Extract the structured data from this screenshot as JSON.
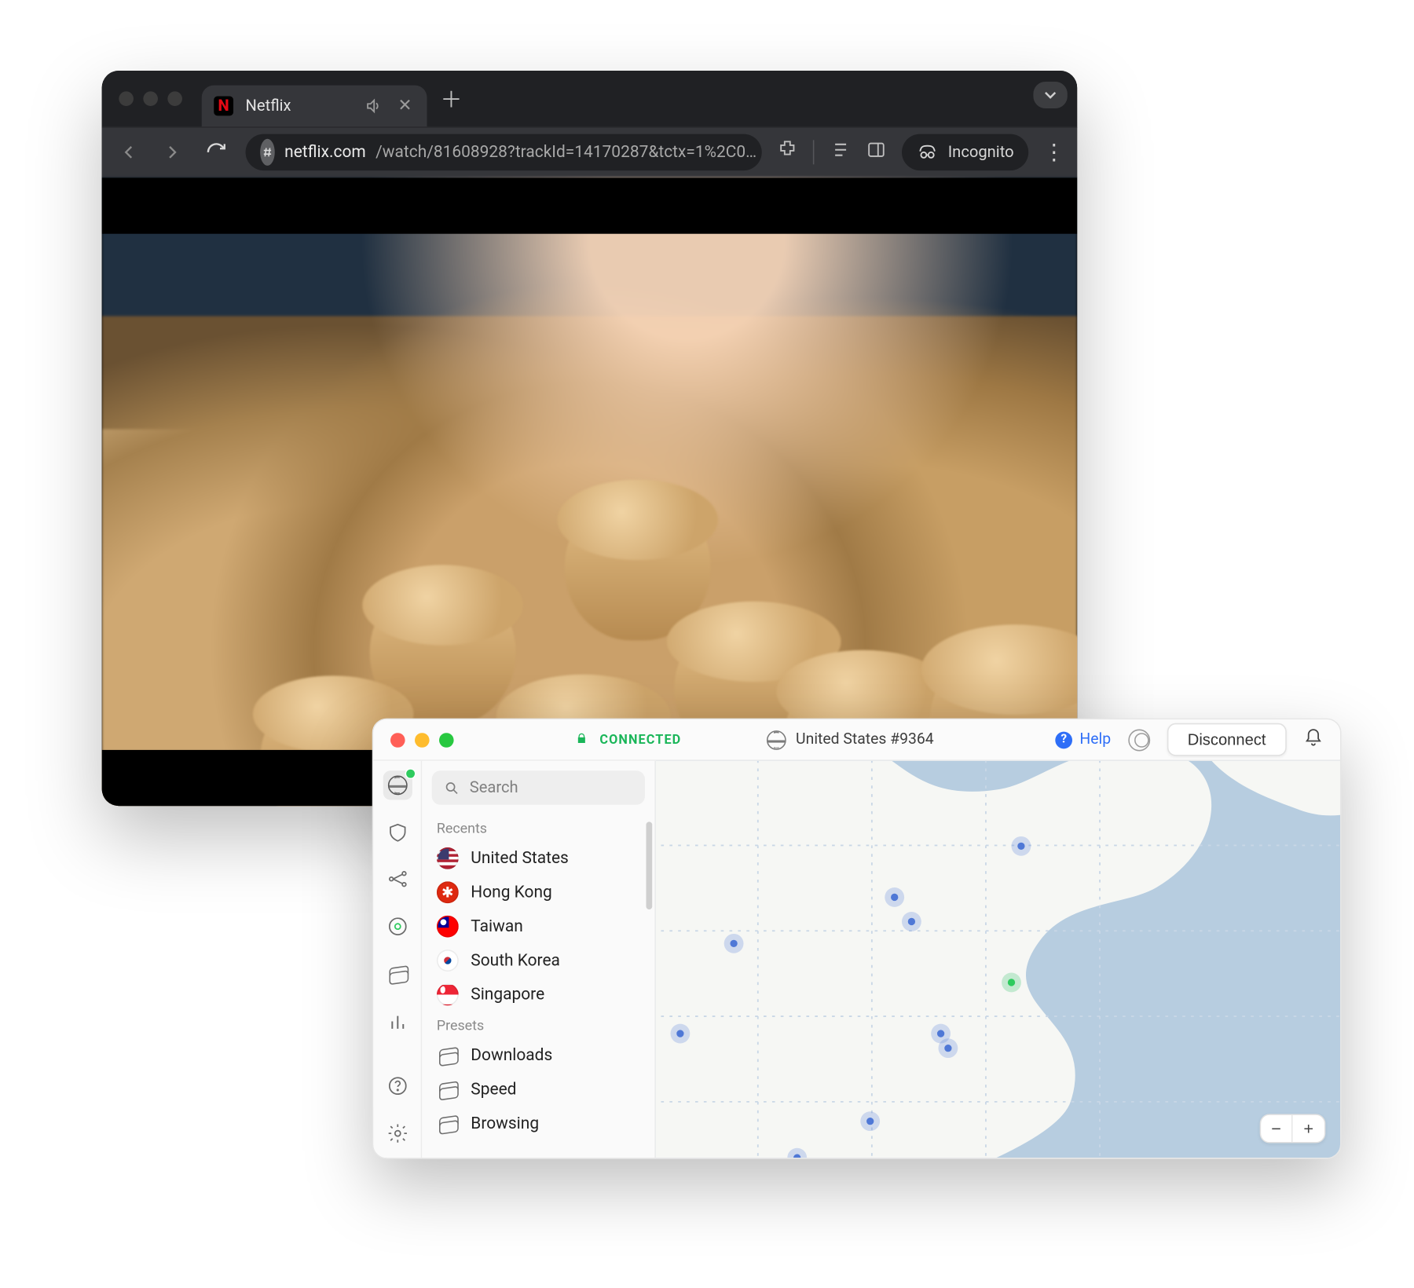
{
  "browser": {
    "tab": {
      "title": "Netflix",
      "favicon_letter": "N"
    },
    "url_domain": "netflix.com",
    "url_path": "/watch/81608928?trackId=14170287&tctx=1%2C0…",
    "incognito_label": "Incognito"
  },
  "vpn": {
    "status_text": "CONNECTED",
    "location": "United States #9364",
    "help_label": "Help",
    "disconnect_label": "Disconnect",
    "search_placeholder": "Search",
    "sections": {
      "recents_label": "Recents",
      "presets_label": "Presets"
    },
    "recents": [
      {
        "label": "United States",
        "flag": "us"
      },
      {
        "label": "Hong Kong",
        "flag": "hk"
      },
      {
        "label": "Taiwan",
        "flag": "tw"
      },
      {
        "label": "South Korea",
        "flag": "kr"
      },
      {
        "label": "Singapore",
        "flag": "sg"
      }
    ],
    "presets": [
      {
        "label": "Downloads"
      },
      {
        "label": "Speed"
      },
      {
        "label": "Browsing"
      }
    ],
    "zoom_minus": "−",
    "zoom_plus": "+"
  }
}
